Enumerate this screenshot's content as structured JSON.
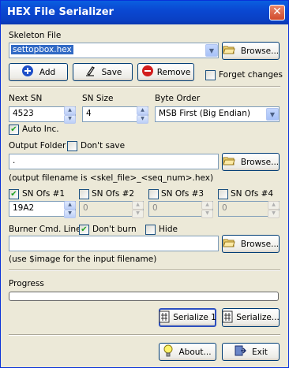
{
  "window": {
    "title": "HEX File Serializer",
    "close_glyph": "✕"
  },
  "skeleton": {
    "label": "Skeleton File",
    "value": "settopbox.hex",
    "browse_label": "Browse...",
    "add_label": "Add",
    "save_label": "Save",
    "remove_label": "Remove",
    "forget_label": "Forget changes",
    "forget_checked": false
  },
  "serial": {
    "next_sn_label": "Next SN",
    "next_sn_value": "4523",
    "sn_size_label": "SN Size",
    "sn_size_value": "4",
    "byte_order_label": "Byte Order",
    "byte_order_value": "MSB First (Big Endian)",
    "auto_inc_label": "Auto Inc.",
    "auto_inc_checked": true
  },
  "output": {
    "label": "Output Folder",
    "dont_save_label": "Don't save",
    "dont_save_checked": false,
    "value": ".",
    "browse_label": "Browse...",
    "hint": "(output filename is <skel_file>_<seq_num>.hex)"
  },
  "offsets": [
    {
      "label": "SN Ofs #1",
      "checked": true,
      "value": "19A2"
    },
    {
      "label": "SN Ofs #2",
      "checked": false,
      "value": "0"
    },
    {
      "label": "SN Ofs #3",
      "checked": false,
      "value": "0"
    },
    {
      "label": "SN Ofs #4",
      "checked": false,
      "value": "0"
    }
  ],
  "burner": {
    "label": "Burner Cmd. Line",
    "dont_burn_label": "Don't burn",
    "dont_burn_checked": true,
    "hide_label": "Hide",
    "hide_checked": false,
    "value": "",
    "browse_label": "Browse...",
    "hint": "(use $image for the input filename)"
  },
  "progress": {
    "label": "Progress",
    "value": 0
  },
  "actions": {
    "serialize1_label": "Serialize 1",
    "serialize_label": "Serialize...",
    "about_label": "About...",
    "exit_label": "Exit"
  }
}
